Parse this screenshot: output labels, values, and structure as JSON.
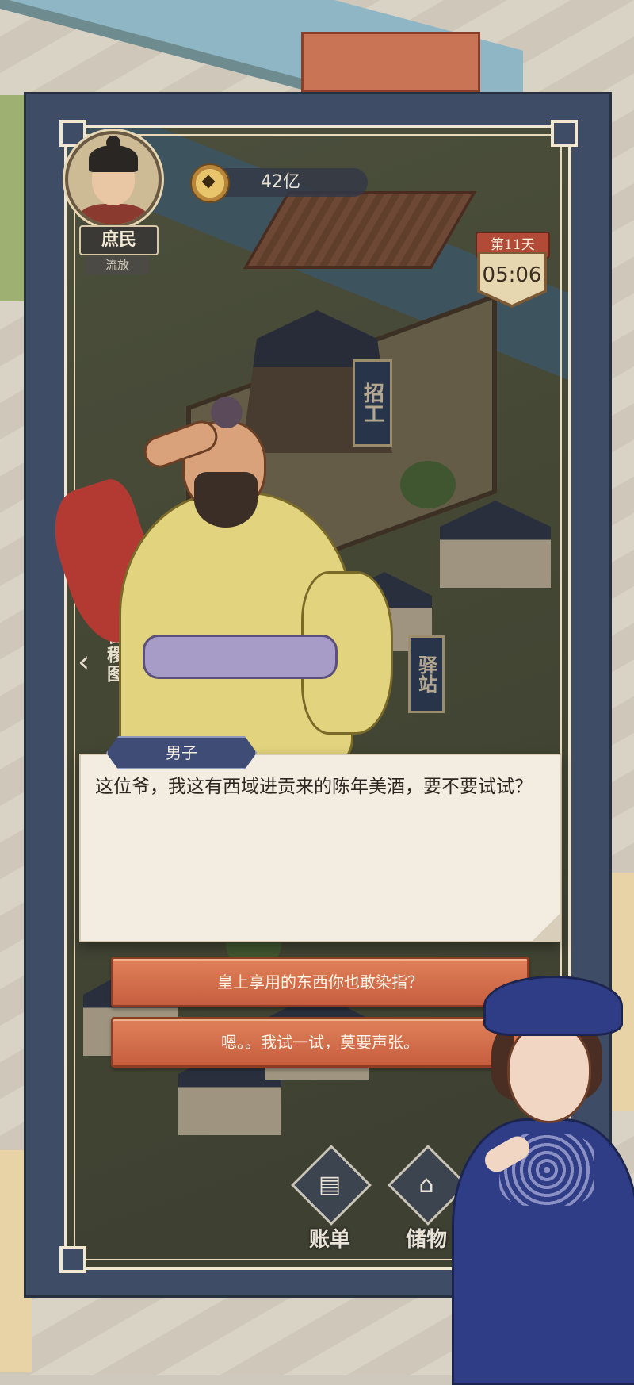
{
  "player": {
    "rank": "庶民",
    "status": "流放"
  },
  "hud": {
    "coins": "42亿",
    "day": "第11天",
    "time": "05:06"
  },
  "side_nav": {
    "map_label": "社稷图"
  },
  "scene": {
    "sign_recruit": "招工",
    "sign_station": "驿站"
  },
  "dialog": {
    "speaker": "男子",
    "text": "这位爷，我这有西域进贡来的陈年美酒，要不要试试？"
  },
  "choices": [
    {
      "label": "皇上享用的东西你也敢染指？"
    },
    {
      "label": "嗯。。我试一试，莫要声张。"
    }
  ],
  "bottom_nav": {
    "ledger_label": "账单",
    "storage_label": "储物"
  },
  "colors": {
    "frame": "#3e4c66",
    "choice_button": "#d06a48",
    "dialog_bg": "#f3ece0",
    "nametag": "#3e4c76",
    "day_badge": "#b24a38"
  }
}
